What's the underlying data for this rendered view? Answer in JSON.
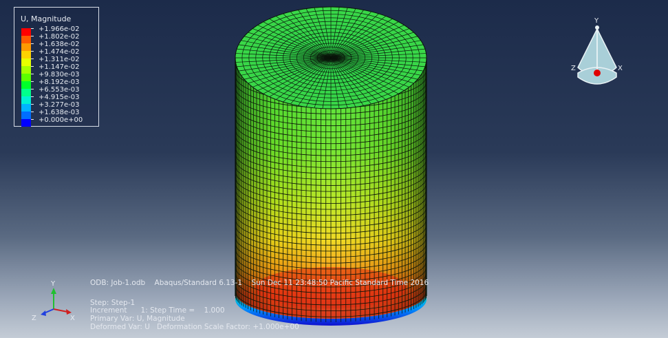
{
  "legend": {
    "title": "U, Magnitude",
    "entries": [
      {
        "value": "+1.966e-02",
        "color": "#ff0000"
      },
      {
        "value": "+1.802e-02",
        "color": "#ff5a00"
      },
      {
        "value": "+1.638e-02",
        "color": "#ff9a00"
      },
      {
        "value": "+1.474e-02",
        "color": "#ffd200"
      },
      {
        "value": "+1.311e-02",
        "color": "#e8ff00"
      },
      {
        "value": "+1.147e-02",
        "color": "#a6ff00"
      },
      {
        "value": "+9.830e-03",
        "color": "#5cff00"
      },
      {
        "value": "+8.192e-03",
        "color": "#00ff2a"
      },
      {
        "value": "+6.553e-03",
        "color": "#00ff8c"
      },
      {
        "value": "+4.915e-03",
        "color": "#00f0d4"
      },
      {
        "value": "+3.277e-03",
        "color": "#00b4ff"
      },
      {
        "value": "+1.638e-03",
        "color": "#006eff"
      },
      {
        "value": "+0.000e+00",
        "color": "#0000ff"
      }
    ]
  },
  "info": {
    "odb_line": "ODB: Job-1.odb    Abaqus/Standard 6.13-1    Sun Dec 11 23:48:50 Pacific Standard Time 2016",
    "step_line": "Step: Step-1",
    "increment_line": "Increment      1: Step Time =    1.000",
    "primary_line": "Primary Var: U, Magnitude",
    "deformed_line": "Deformed Var: U   Deformation Scale Factor: +1.000e+00"
  },
  "triad_small": {
    "x": "X",
    "y": "Y",
    "z": "Z"
  },
  "triad_view": {
    "x": "X",
    "y": "Y",
    "z": "Z"
  },
  "colors": {
    "background_top": "#1c2b4a",
    "background_bottom": "#c4ccd6",
    "mesh_line": "#0a1a0a",
    "triad_fill": "#a9cfd8"
  }
}
